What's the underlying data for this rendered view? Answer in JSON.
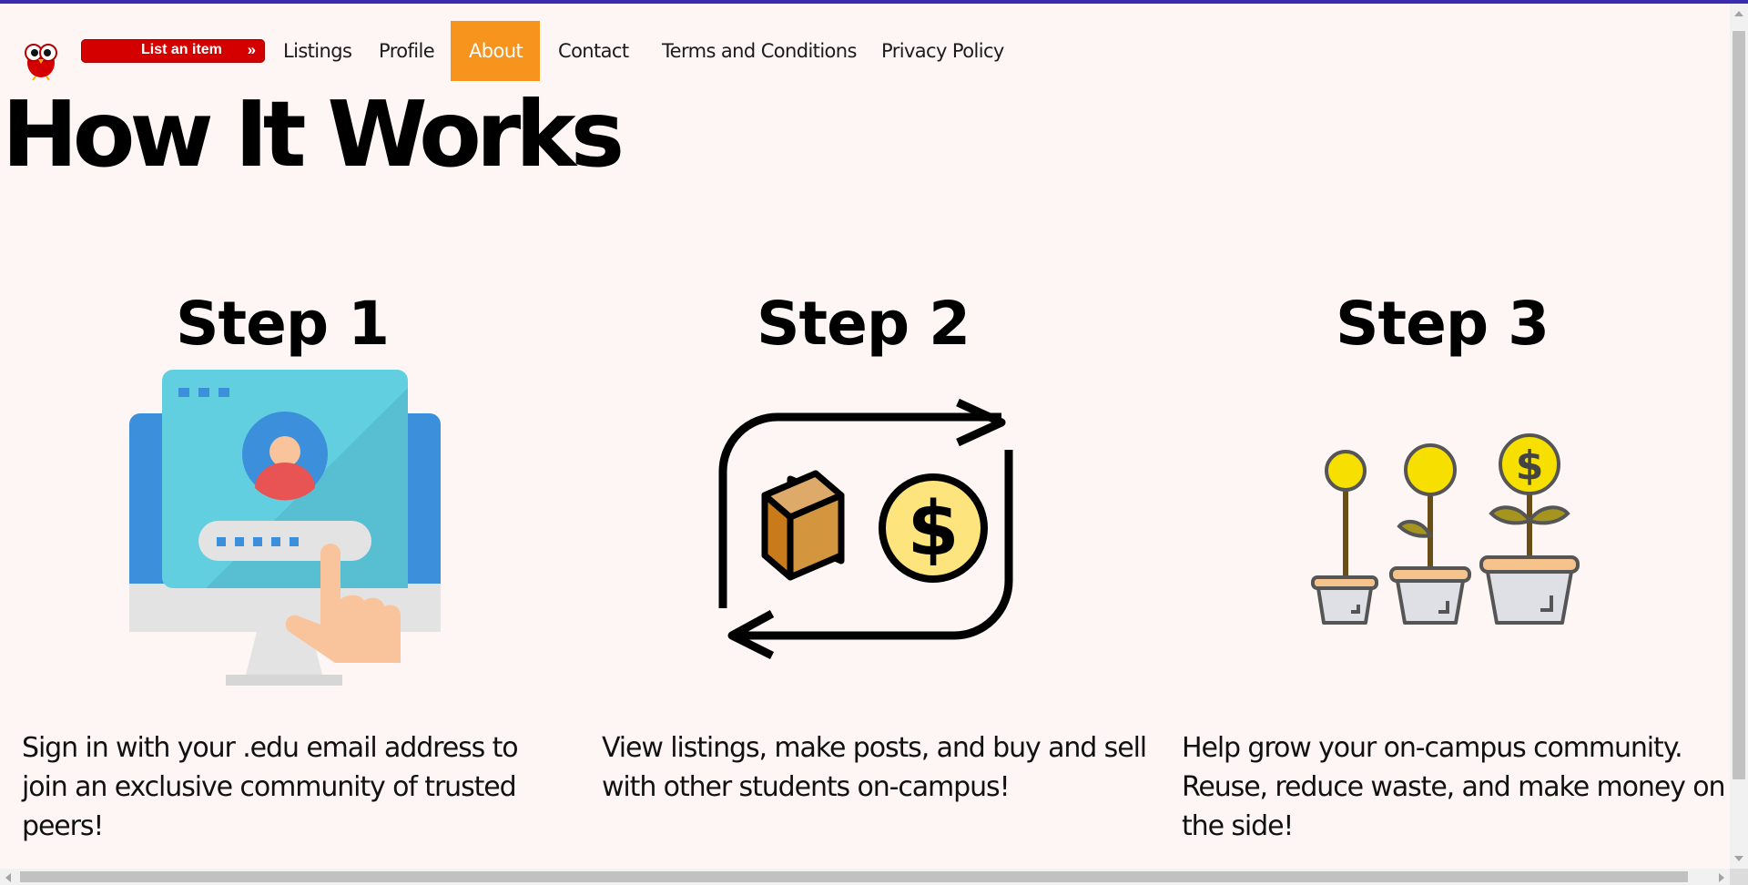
{
  "nav": {
    "list_item_label": "List an item",
    "list_item_arrow": "››",
    "items": [
      {
        "label": "Listings"
      },
      {
        "label": "Profile"
      },
      {
        "label": "About"
      },
      {
        "label": "Contact"
      },
      {
        "label": "Terms and Conditions"
      },
      {
        "label": "Privacy Policy"
      }
    ],
    "active": "About",
    "active_color": "#f7941d",
    "button_color": "#d40000"
  },
  "page": {
    "title": "How It Works",
    "background": "#fdf6f5"
  },
  "steps": [
    {
      "title": "Step 1",
      "description": "Sign in with your .edu email address to join an exclusive community of trusted peers!",
      "icon": "login-computer-icon"
    },
    {
      "title": "Step 2",
      "description": "View listings, make posts, and buy and sell with other students on-campus!",
      "icon": "exchange-box-dollar-icon"
    },
    {
      "title": "Step 3",
      "description": "Help grow your on-campus community. Reuse, reduce waste, and make money on the side!",
      "icon": "money-plant-growth-icon"
    }
  ]
}
